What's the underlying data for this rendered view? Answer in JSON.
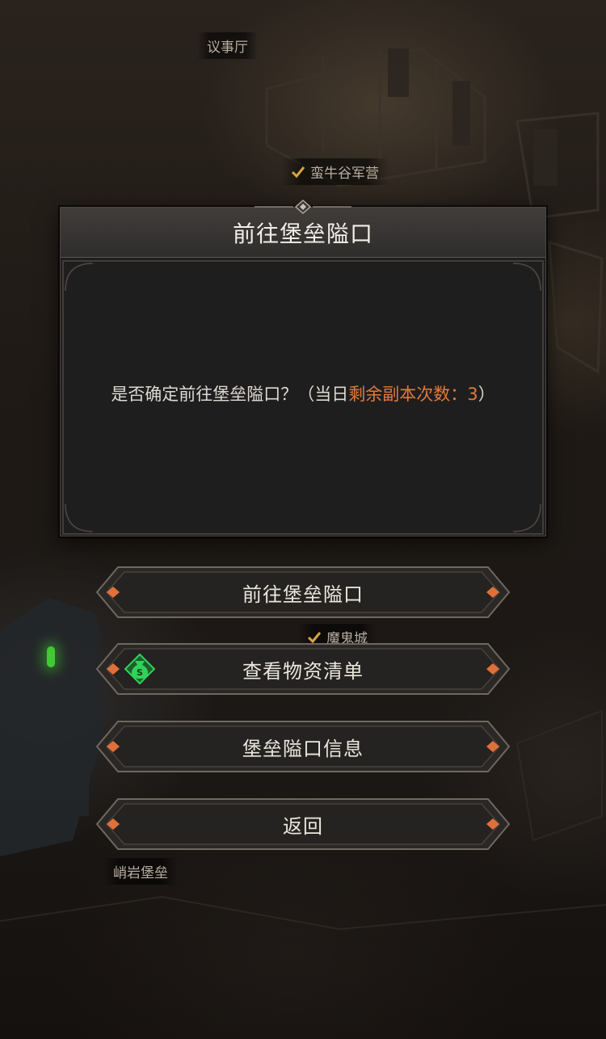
{
  "map": {
    "labels": [
      {
        "name": "map-label-council-hall",
        "text": "议事厅",
        "checked": false
      },
      {
        "name": "map-label-bull-valley-camp",
        "text": "蛮牛谷军营",
        "checked": true
      },
      {
        "name": "map-label-demon-city",
        "text": "魔鬼城",
        "checked": true
      },
      {
        "name": "map-label-cliff-fortress",
        "text": "峭岩堡垒",
        "checked": false
      }
    ]
  },
  "dialog": {
    "title": "前往堡垒隘口",
    "message_prefix": "是否确定前往堡垒隘口？（当日",
    "message_highlight": "剩余副本次数：3",
    "message_suffix": "）",
    "highlight_color": "#e07a3c"
  },
  "buttons": {
    "go": "前往堡垒隘口",
    "view_supplies": "查看物资清单",
    "info": "堡垒隘口信息",
    "back": "返回"
  },
  "icons": {
    "supplies_icon": "money-bag-icon",
    "supplies_icon_color": "#2fd35a"
  }
}
